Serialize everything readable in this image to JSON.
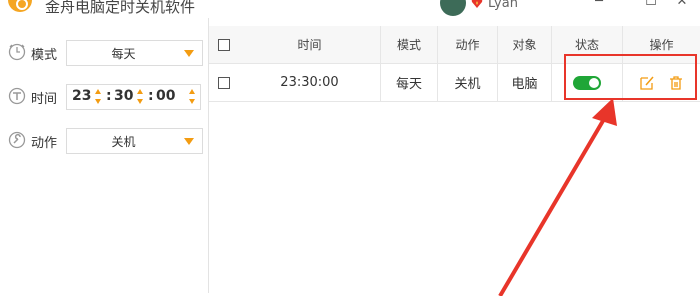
{
  "window": {
    "app_title": "金舟电脑定时关机软件",
    "user_name": "Lyan",
    "minimize": "─",
    "maximize": "☐",
    "close": "✕"
  },
  "form": {
    "mode_label": "模式",
    "mode_value": "每天",
    "time_label": "时间",
    "time_hour": "23",
    "time_minute": "30",
    "time_second": "00",
    "action_label": "动作",
    "action_value": "关机"
  },
  "table": {
    "headers": [
      "时间",
      "模式",
      "动作",
      "对象",
      "状态",
      "操作"
    ],
    "rows": [
      {
        "time": "23:30:00",
        "mode": "每天",
        "action": "关机",
        "target": "电脑",
        "enabled": true
      }
    ]
  },
  "colors": {
    "accent": "#f39c12",
    "toggle_on": "#1fa637",
    "highlight": "#e8352a"
  },
  "icons": [
    "app-logo",
    "avatar",
    "vip-heart-icon",
    "clock-icon",
    "time-icon",
    "wrench-icon",
    "edit-icon",
    "trash-icon"
  ]
}
